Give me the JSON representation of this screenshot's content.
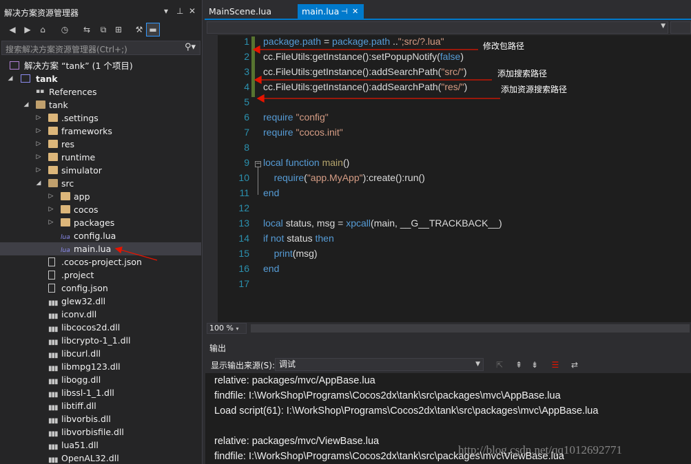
{
  "solution_explorer": {
    "title": "解决方案资源管理器",
    "title_buttons": [
      "▾",
      "⊥",
      "✕"
    ],
    "search_placeholder": "搜索解决方案资源管理器(Ctrl+;)",
    "tree": [
      {
        "label": "解决方案 “tank” (1 个项目)",
        "kind": "solution",
        "level": 0,
        "arrow": ""
      },
      {
        "label": "tank",
        "kind": "project",
        "level": 0,
        "arrow": "◢",
        "bold": true
      },
      {
        "label": "References",
        "kind": "references",
        "level": 1,
        "arrow": ""
      },
      {
        "label": "tank",
        "kind": "folder-open",
        "level": 1,
        "arrow": "◢"
      },
      {
        "label": ".settings",
        "kind": "folder",
        "level": 2,
        "arrow": "▷"
      },
      {
        "label": "frameworks",
        "kind": "folder",
        "level": 2,
        "arrow": "▷"
      },
      {
        "label": "res",
        "kind": "folder",
        "level": 2,
        "arrow": "▷"
      },
      {
        "label": "runtime",
        "kind": "folder",
        "level": 2,
        "arrow": "▷"
      },
      {
        "label": "simulator",
        "kind": "folder",
        "level": 2,
        "arrow": "▷"
      },
      {
        "label": "src",
        "kind": "folder-open",
        "level": 2,
        "arrow": "◢"
      },
      {
        "label": "app",
        "kind": "folder",
        "level": 3,
        "arrow": "▷"
      },
      {
        "label": "cocos",
        "kind": "folder",
        "level": 3,
        "arrow": "▷"
      },
      {
        "label": "packages",
        "kind": "folder",
        "level": 3,
        "arrow": "▷"
      },
      {
        "label": "config.lua",
        "kind": "lua",
        "level": 3,
        "arrow": ""
      },
      {
        "label": "main.lua",
        "kind": "lua",
        "level": 3,
        "arrow": "",
        "selected": true
      },
      {
        "label": ".cocos-project.json",
        "kind": "json",
        "level": 2,
        "arrow": ""
      },
      {
        "label": ".project",
        "kind": "file",
        "level": 2,
        "arrow": ""
      },
      {
        "label": "config.json",
        "kind": "json",
        "level": 2,
        "arrow": ""
      },
      {
        "label": "glew32.dll",
        "kind": "dll",
        "level": 2,
        "arrow": ""
      },
      {
        "label": "iconv.dll",
        "kind": "dll",
        "level": 2,
        "arrow": ""
      },
      {
        "label": "libcocos2d.dll",
        "kind": "dll",
        "level": 2,
        "arrow": ""
      },
      {
        "label": "libcrypto-1_1.dll",
        "kind": "dll",
        "level": 2,
        "arrow": ""
      },
      {
        "label": "libcurl.dll",
        "kind": "dll",
        "level": 2,
        "arrow": ""
      },
      {
        "label": "libmpg123.dll",
        "kind": "dll",
        "level": 2,
        "arrow": ""
      },
      {
        "label": "libogg.dll",
        "kind": "dll",
        "level": 2,
        "arrow": ""
      },
      {
        "label": "libssl-1_1.dll",
        "kind": "dll",
        "level": 2,
        "arrow": ""
      },
      {
        "label": "libtiff.dll",
        "kind": "dll",
        "level": 2,
        "arrow": ""
      },
      {
        "label": "libvorbis.dll",
        "kind": "dll",
        "level": 2,
        "arrow": ""
      },
      {
        "label": "libvorbisfile.dll",
        "kind": "dll",
        "level": 2,
        "arrow": ""
      },
      {
        "label": "lua51.dll",
        "kind": "dll",
        "level": 2,
        "arrow": ""
      },
      {
        "label": "OpenAL32.dll",
        "kind": "dll",
        "level": 2,
        "arrow": ""
      }
    ]
  },
  "editor": {
    "tabs": [
      {
        "label": "MainScene.lua",
        "active": false
      },
      {
        "label": "main.lua",
        "active": true,
        "pin": "⊣",
        "close": "✕"
      }
    ],
    "zoom": "100 %",
    "lines": [
      {
        "n": "1",
        "tokens": [
          [
            "var",
            "package.path"
          ],
          [
            "t",
            " = "
          ],
          [
            "var",
            "package.path"
          ],
          [
            "t",
            " .."
          ],
          [
            "str",
            "\";src/?.lua\""
          ]
        ],
        "changed": true
      },
      {
        "n": "2",
        "tokens": [
          [
            "t",
            "cc.FileUtils:getInstance():setPopupNotify("
          ],
          [
            "kw",
            "false"
          ],
          [
            "t",
            ")"
          ]
        ],
        "changed": true
      },
      {
        "n": "3",
        "tokens": [
          [
            "t",
            "cc.FileUtils:getInstance():addSearchPath("
          ],
          [
            "str",
            "\"src/\""
          ],
          [
            "t",
            ")"
          ]
        ],
        "changed": true
      },
      {
        "n": "4",
        "tokens": [
          [
            "t",
            "cc.FileUtils:getInstance():addSearchPath("
          ],
          [
            "str",
            "\"res/\""
          ],
          [
            "t",
            ")"
          ]
        ],
        "changed": true
      },
      {
        "n": "5",
        "tokens": []
      },
      {
        "n": "6",
        "tokens": [
          [
            "kw",
            "require "
          ],
          [
            "str",
            "\"config\""
          ]
        ]
      },
      {
        "n": "7",
        "tokens": [
          [
            "kw",
            "require "
          ],
          [
            "str",
            "\"cocos.init\""
          ]
        ]
      },
      {
        "n": "8",
        "tokens": []
      },
      {
        "n": "9",
        "tokens": [
          [
            "kw",
            "local function "
          ],
          [
            "fn",
            "main"
          ],
          [
            "t",
            "()"
          ]
        ],
        "fold": true
      },
      {
        "n": "10",
        "tokens": [
          [
            "t",
            "    "
          ],
          [
            "kw",
            "require"
          ],
          [
            "t",
            "("
          ],
          [
            "str",
            "\"app.MyApp\""
          ],
          [
            "t",
            "):create():run()"
          ]
        ]
      },
      {
        "n": "11",
        "tokens": [
          [
            "kw",
            "end"
          ]
        ]
      },
      {
        "n": "12",
        "tokens": []
      },
      {
        "n": "13",
        "tokens": [
          [
            "kw",
            "local "
          ],
          [
            "t",
            "status, msg = "
          ],
          [
            "kw",
            "xpcall"
          ],
          [
            "t",
            "(main, __G__TRACKBACK__)"
          ]
        ]
      },
      {
        "n": "14",
        "tokens": [
          [
            "kw",
            "if not "
          ],
          [
            "t",
            "status "
          ],
          [
            "kw",
            "then"
          ]
        ]
      },
      {
        "n": "15",
        "tokens": [
          [
            "t",
            "    "
          ],
          [
            "kw",
            "print"
          ],
          [
            "t",
            "(msg)"
          ]
        ]
      },
      {
        "n": "16",
        "tokens": [
          [
            "kw",
            "end"
          ]
        ]
      },
      {
        "n": "17",
        "tokens": []
      }
    ],
    "annotations": [
      {
        "text": "修改包路径",
        "line": 1
      },
      {
        "text": "添加搜索路径",
        "line": 3
      },
      {
        "text": "添加资源搜索路径",
        "line": 4
      }
    ]
  },
  "output": {
    "title": "输出",
    "source_label": "显示输出来源(S):",
    "source_value": "调试",
    "lines": [
      "relative: packages/mvc/AppBase.lua",
      "findfile: I:\\WorkShop\\Programs\\Cocos2dx\\tank\\src\\packages\\mvc\\AppBase.lua",
      "Load script(61): I:\\WorkShop\\Programs\\Cocos2dx\\tank\\src\\packages\\mvc\\AppBase.lua",
      "",
      "relative: packages/mvc/ViewBase.lua",
      "findfile: I:\\WorkShop\\Programs\\Cocos2dx\\tank\\src\\packages\\mvc\\ViewBase.lua"
    ]
  },
  "watermark": "http://blog.csdn.net/qq1012692771",
  "colors": {
    "accent": "#007acc",
    "annotation_arrow": "#e51400",
    "keyword": "#569cd6",
    "string": "#d69d85",
    "line_number": "#2b91af"
  }
}
